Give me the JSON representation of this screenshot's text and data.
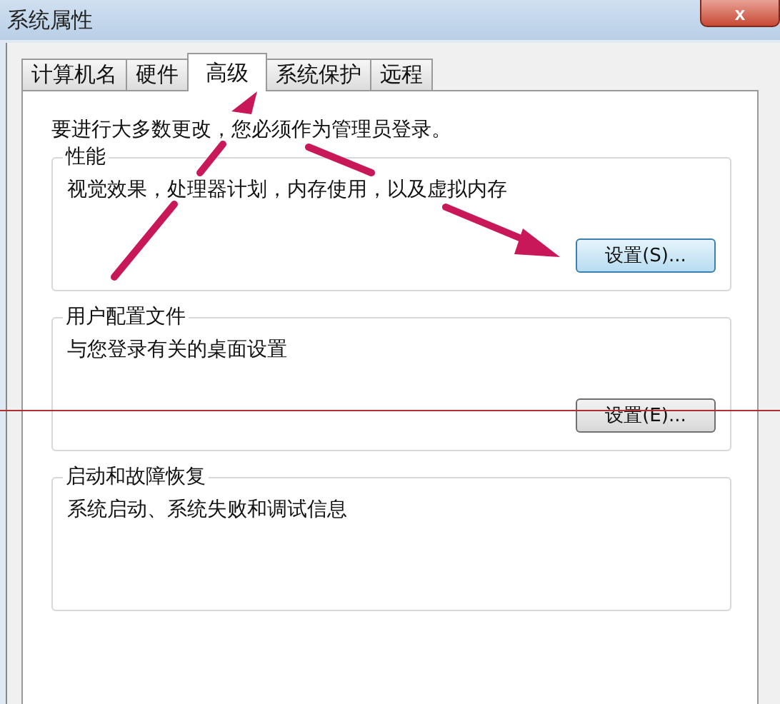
{
  "window": {
    "title": "系统属性",
    "close_button": "x"
  },
  "tabs": [
    {
      "label": "计算机名",
      "selected": false
    },
    {
      "label": "硬件",
      "selected": false
    },
    {
      "label": "高级",
      "selected": true
    },
    {
      "label": "系统保护",
      "selected": false
    },
    {
      "label": "远程",
      "selected": false
    }
  ],
  "notice": "要进行大多数更改，您必须作为管理员登录。",
  "groups": [
    {
      "title": "性能",
      "description": "视觉效果，处理器计划，内存使用，以及虚拟内存",
      "button": "设置(S)...",
      "button_highlighted": true
    },
    {
      "title": "用户配置文件",
      "description": "与您登录有关的桌面设置",
      "button": "设置(E)...",
      "button_highlighted": false
    },
    {
      "title": "启动和故障恢复",
      "description": "系统启动、系统失败和调试信息"
    }
  ]
}
